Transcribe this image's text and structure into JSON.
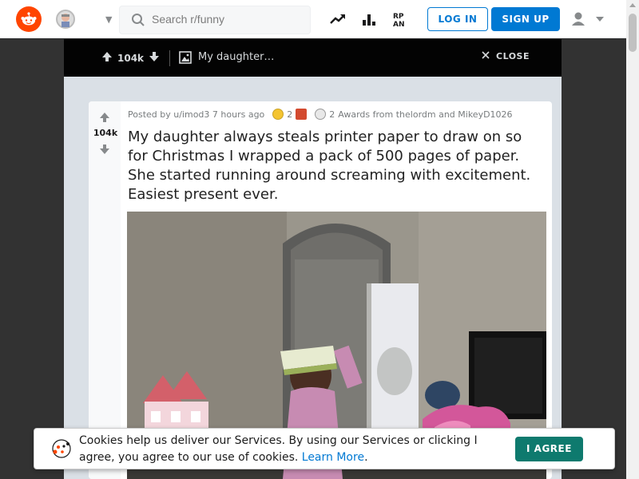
{
  "header": {
    "search_placeholder": "Search r/funny",
    "login_label": "LOG IN",
    "signup_label": "SIGN UP",
    "icons": [
      "reddit-logo",
      "subreddit-icon",
      "chevron-down-icon",
      "search-icon",
      "trending-icon",
      "stats-icon",
      "rpan-icon",
      "user-icon",
      "caret-down-icon"
    ]
  },
  "post_bar": {
    "score": "104k",
    "title_short": "My daughter…",
    "close_label": "CLOSE"
  },
  "post": {
    "score": "104k",
    "posted_by": "Posted by u/imod3 7 hours ago",
    "award_count_1": "2",
    "award_count_2": "2",
    "awards_text": "Awards from thelordm and MikeyD1026",
    "title": "My daughter always steals printer paper to draw on so for Christmas I wrapped a pack of 500 pages of paper. She started running around screaming with excitement. Easiest present ever."
  },
  "cookie_banner": {
    "text": "Cookies help us deliver our Services. By using our Services or clicking I agree, you agree to our use of cookies.",
    "link_text": "Learn More",
    "end_punct": ".",
    "agree_label": "I AGREE"
  },
  "colors": {
    "brand": "#ff4500",
    "accent": "#0079d3",
    "agree": "#0e7a6e"
  }
}
